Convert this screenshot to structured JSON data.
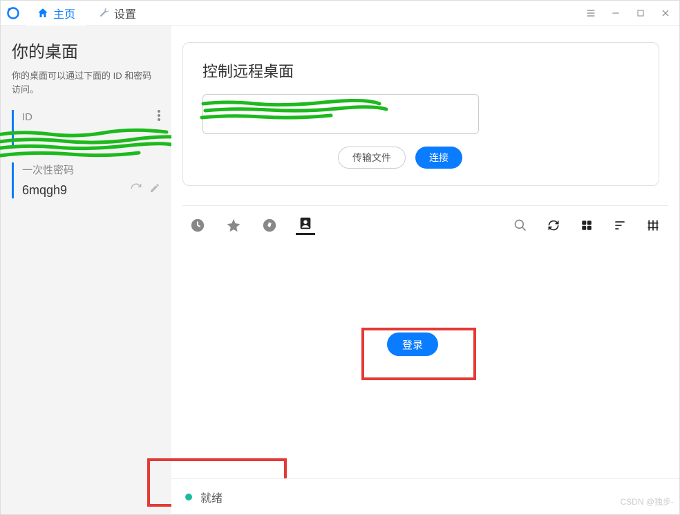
{
  "tabs": {
    "home": "主页",
    "settings": "设置"
  },
  "sidebar": {
    "title": "你的桌面",
    "desc": "你的桌面可以通过下面的 ID 和密码访问。",
    "id_label": "ID",
    "id_value": "",
    "pw_label": "一次性密码",
    "pw_value": "6mqgh9"
  },
  "main": {
    "control_title": "控制远程桌面",
    "id_placeholder": "",
    "transfer_btn": "传输文件",
    "connect_btn": "连接",
    "login_btn": "登录"
  },
  "toolbar_icons": {
    "recent": "recent-icon",
    "fav": "star-icon",
    "discover": "compass-icon",
    "ab": "addressbook-icon",
    "search": "search-icon",
    "refresh": "refresh-icon",
    "grid": "grid-icon",
    "sort": "sort-icon",
    "tags": "tags-icon"
  },
  "status": {
    "text": "就绪"
  },
  "watermark": "CSDN @独步-"
}
